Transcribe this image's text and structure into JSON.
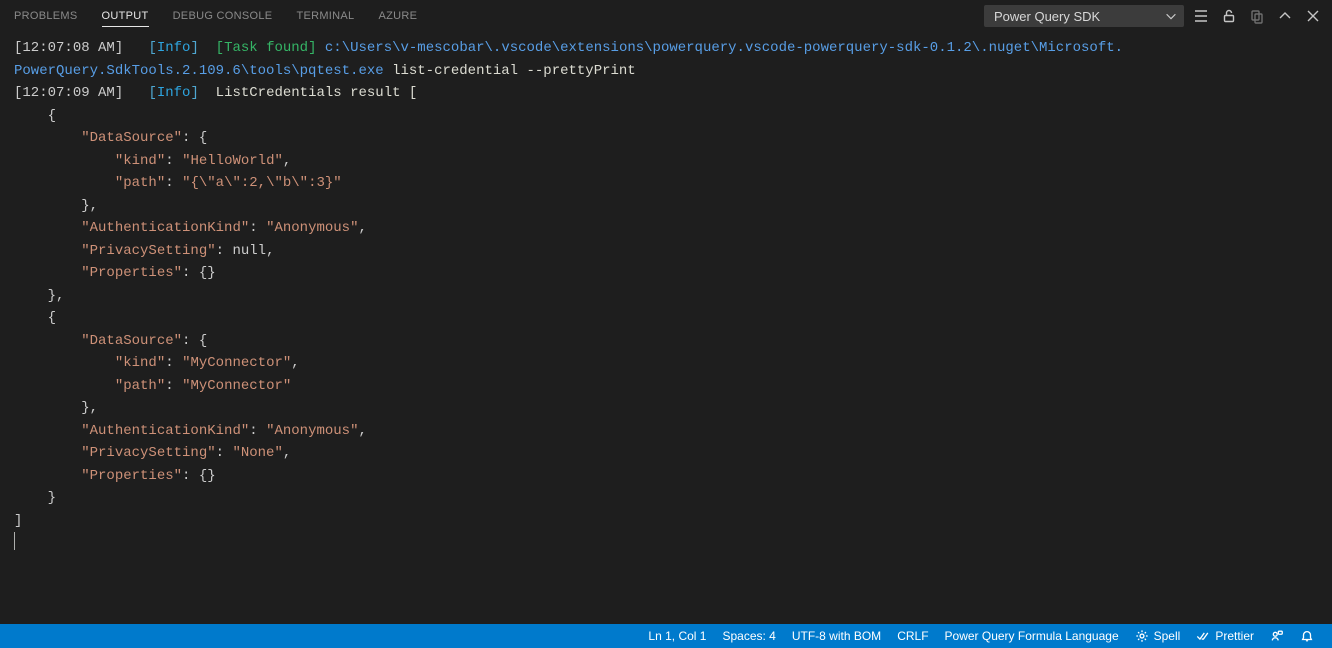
{
  "panel": {
    "tabs": [
      {
        "id": "problems",
        "label": "PROBLEMS",
        "active": false
      },
      {
        "id": "output",
        "label": "OUTPUT",
        "active": true
      },
      {
        "id": "debug",
        "label": "DEBUG CONSOLE",
        "active": false
      },
      {
        "id": "terminal",
        "label": "TERMINAL",
        "active": false
      },
      {
        "id": "azure",
        "label": "AZURE",
        "active": false
      }
    ],
    "filter": "Power Query SDK"
  },
  "colors": {
    "time": "#cccccc",
    "info_outer": "#4fa7d1",
    "info_inner": "#2ea5e0",
    "task": "#35b566",
    "path": "#589ee6",
    "default": "#dcdcd2",
    "string": "#ce9178"
  },
  "log": {
    "line1": {
      "time": "12:07:08 AM",
      "level": "Info",
      "task": "Task found",
      "path": "c:\\Users\\v-mescobar\\.vscode\\extensions\\powerquery.vscode-powerquery-sdk-0.1.2\\.nuget\\Microsoft.PowerQuery.SdkTools.2.109.6\\tools\\pqtest.exe",
      "args": "list-credential --prettyPrint"
    },
    "line2": {
      "time": "12:07:09 AM",
      "level": "Info",
      "msg": "ListCredentials result ["
    },
    "result": [
      {
        "DataSource": {
          "kind": "HelloWorld",
          "path": "{\\\"a\\\":2,\\\"b\\\":3}"
        },
        "AuthenticationKind": "Anonymous",
        "PrivacySetting": null,
        "Properties": {}
      },
      {
        "DataSource": {
          "kind": "MyConnector",
          "path": "MyConnector"
        },
        "AuthenticationKind": "Anonymous",
        "PrivacySetting": "None",
        "Properties": {}
      }
    ]
  },
  "statusbar": {
    "lncol": "Ln 1, Col 1",
    "spaces": "Spaces: 4",
    "encoding": "UTF-8 with BOM",
    "eol": "CRLF",
    "lang": "Power Query Formula Language",
    "spell": "Spell",
    "prettier": "Prettier"
  }
}
